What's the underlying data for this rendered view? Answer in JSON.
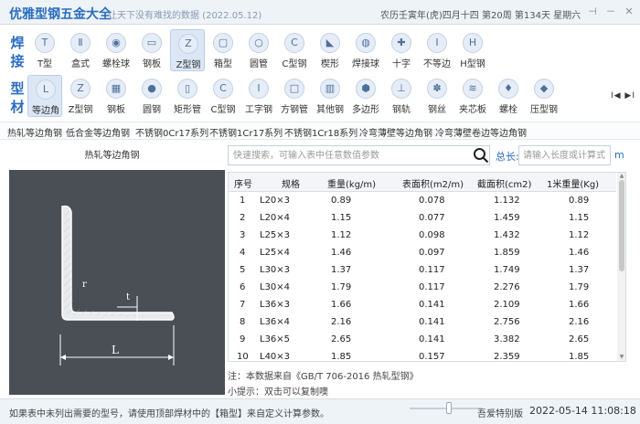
{
  "window": {
    "title": "优雅型钢五金大全",
    "subtitle": "让天下没有难找的数据 (2022.05.12)",
    "lunar_date": "农历壬寅年(虎)四月十四 第20周 第134天 星期六",
    "pin_symbol": "⊣",
    "min_symbol": "－",
    "close_symbol": "✕"
  },
  "toolbar": {
    "group1_label": [
      "焊",
      "接"
    ],
    "group2_label": [
      "型",
      "材"
    ],
    "row1": [
      {
        "label": "T型",
        "icon": "T"
      },
      {
        "label": "盒式",
        "icon": "Ⅱ"
      },
      {
        "label": "螺栓球",
        "icon": "◉"
      },
      {
        "label": "钢板",
        "icon": "▭"
      },
      {
        "label": "Z型钢",
        "icon": "Z"
      },
      {
        "label": "箱型",
        "icon": "▢"
      },
      {
        "label": "圆管",
        "icon": "○"
      },
      {
        "label": "C型钢",
        "icon": "C"
      },
      {
        "label": "楔形",
        "icon": "◣"
      },
      {
        "label": "焊接球",
        "icon": "◍"
      },
      {
        "label": "十字",
        "icon": "✚"
      },
      {
        "label": "不等边",
        "icon": "I"
      },
      {
        "label": "H型钢",
        "icon": "H"
      }
    ],
    "row2": [
      {
        "label": "等边角",
        "icon": "L"
      },
      {
        "label": "Z型钢",
        "icon": "Z"
      },
      {
        "label": "钢板",
        "icon": "▦"
      },
      {
        "label": "圆钢",
        "icon": "●"
      },
      {
        "label": "矩形管",
        "icon": "▯"
      },
      {
        "label": "C型钢",
        "icon": "C"
      },
      {
        "label": "工字钢",
        "icon": "I"
      },
      {
        "label": "方钢管",
        "icon": "□"
      },
      {
        "label": "其他钢",
        "icon": "▥"
      },
      {
        "label": "多边形",
        "icon": "⬢"
      },
      {
        "label": "钢轨",
        "icon": "⊥"
      },
      {
        "label": "钢丝",
        "icon": "✽"
      },
      {
        "label": "夹芯板",
        "icon": "≋"
      },
      {
        "label": "螺栓",
        "icon": "♦"
      },
      {
        "label": "压型钢",
        "icon": "◆"
      }
    ],
    "nav_arrows": "I◀ ▶I"
  },
  "subtypes": [
    "热轧等边角钢",
    "低合金等边角钢",
    "不锈钢0Cr17系列",
    "不锈钢1Cr17系列",
    "不锈钢1Cr18系列",
    "冷弯薄壁等边角钢",
    "冷弯薄壁卷边等边角钢"
  ],
  "left_panel": {
    "title": "热轧等边角钢",
    "dim_L": "L",
    "dim_r": "r",
    "dim_t": "t"
  },
  "search": {
    "placeholder": "快速搜索，可输入表中任意数值参数",
    "length_label": "总长:",
    "length_placeholder": "请输入长度或计算式",
    "length_unit": "m"
  },
  "table": {
    "headers": [
      "序号",
      "规格",
      "重量(kg/m)",
      "表面积(m2/m)",
      "截面积(cm2)",
      "1米重量(Kg)"
    ],
    "rows": [
      [
        "1",
        "L20×3",
        "0.89",
        "0.078",
        "1.132",
        "0.89"
      ],
      [
        "2",
        "L20×4",
        "1.15",
        "0.077",
        "1.459",
        "1.15"
      ],
      [
        "3",
        "L25×3",
        "1.12",
        "0.098",
        "1.432",
        "1.12"
      ],
      [
        "4",
        "L25×4",
        "1.46",
        "0.097",
        "1.859",
        "1.46"
      ],
      [
        "5",
        "L30×3",
        "1.37",
        "0.117",
        "1.749",
        "1.37"
      ],
      [
        "6",
        "L30×4",
        "1.79",
        "0.117",
        "2.276",
        "1.79"
      ],
      [
        "7",
        "L36×3",
        "1.66",
        "0.141",
        "2.109",
        "1.66"
      ],
      [
        "8",
        "L36×4",
        "2.16",
        "0.141",
        "2.756",
        "2.16"
      ],
      [
        "9",
        "L36×5",
        "2.65",
        "0.141",
        "3.382",
        "2.65"
      ],
      [
        "10",
        "L40×3",
        "1.85",
        "0.157",
        "2.359",
        "1.85"
      ],
      [
        "11",
        "L40×4",
        "2.42",
        "0.157",
        "3.086",
        "2.42"
      ]
    ]
  },
  "notes": {
    "source": "注：本数据来自《GB/T 706-2016  热轧型钢》",
    "tip": "小提示：双击可以复制噢"
  },
  "status": {
    "message": "如果表中未列出需要的型号，请使用顶部焊材中的【箱型】来自定义计算参数。",
    "edition": "吾爱特别版",
    "datetime": "2022-05-14 11:08:18"
  },
  "colors": {
    "accent": "#2a6cc0",
    "drawing_bg": "#4a4f56"
  }
}
